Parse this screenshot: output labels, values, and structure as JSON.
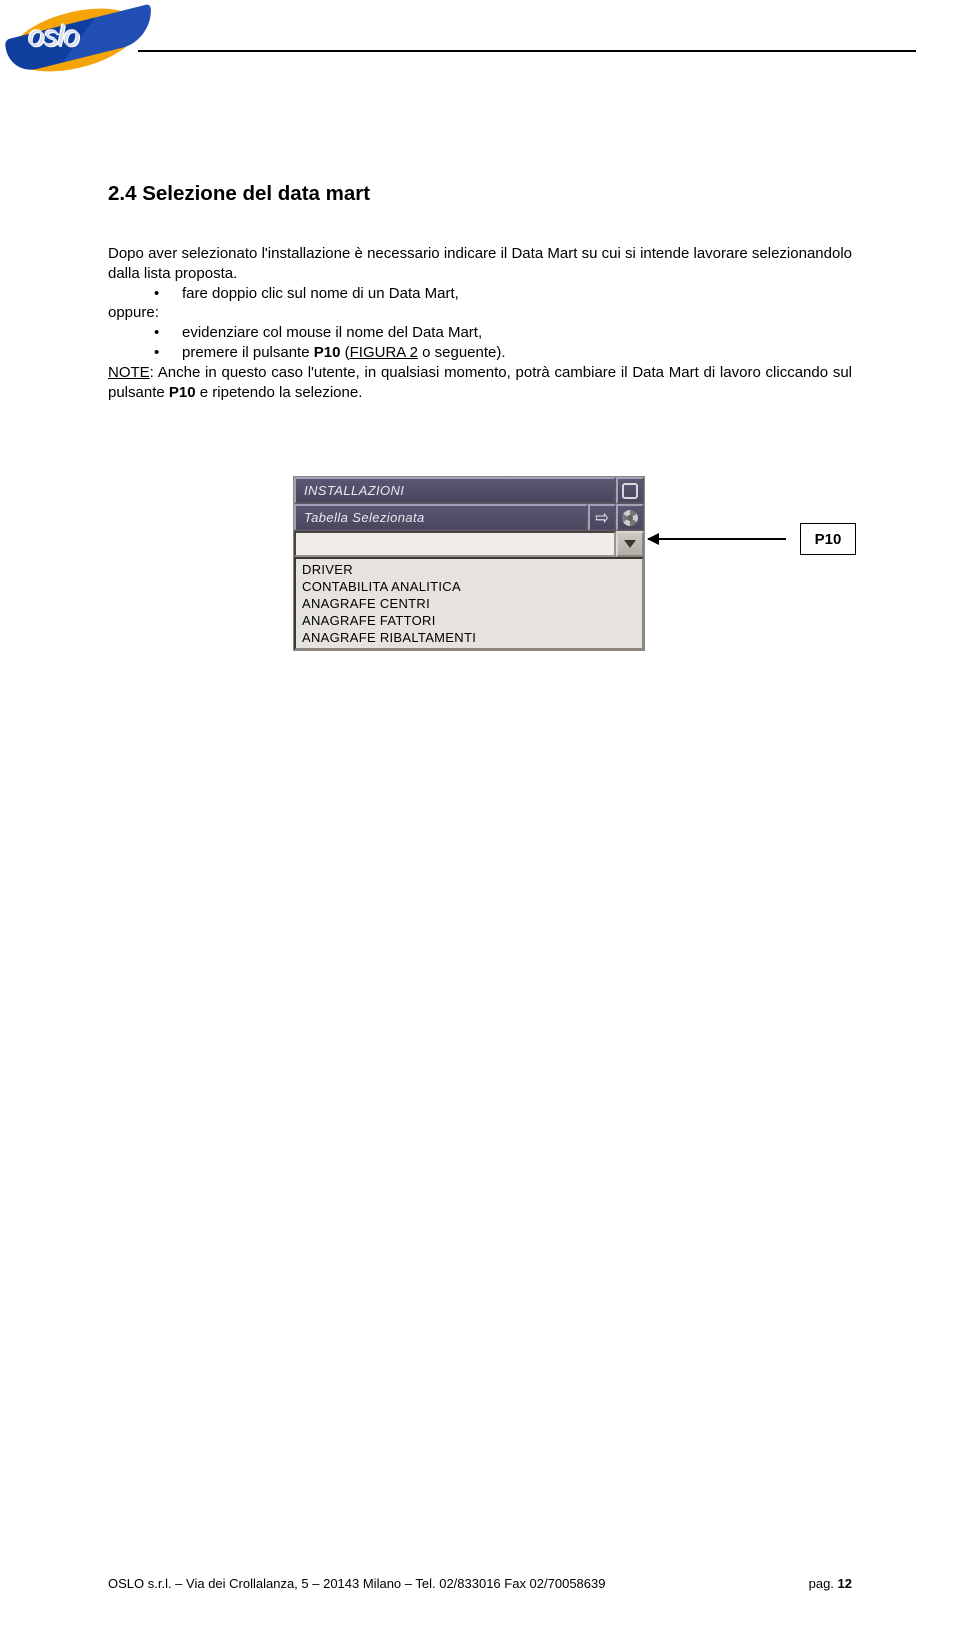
{
  "logo": {
    "text": "oslo"
  },
  "section": {
    "title": "2.4 Selezione del data mart",
    "para1": "Dopo aver selezionato l'installazione è necessario indicare il Data Mart su cui si intende lavorare selezionandolo dalla lista proposta.",
    "bullet1": "fare doppio clic sul nome di un Data Mart,",
    "oppure": "oppure:",
    "bullet2": "evidenziare col mouse il nome del Data Mart,",
    "bullet3_pre": "premere il pulsante ",
    "bullet3_bold": "P10",
    "bullet3_mid": " (",
    "bullet3_link": "FIGURA 2",
    "bullet3_post": " o seguente).",
    "note_label": "NOTE",
    "note_mid1": ": Anche in questo caso l'utente, in qualsiasi momento, potrà cambiare il Data Mart di lavoro cliccando sul pulsante ",
    "note_bold": "P10",
    "note_mid2": " e ripetendo la selezione."
  },
  "panel": {
    "row1_title": "INSTALLAZIONI",
    "row2_title": "Tabella Selezionata",
    "list_items": [
      "DRIVER",
      "CONTABILITA ANALITICA",
      "ANAGRAFE CENTRI",
      "ANAGRAFE FATTORI",
      "ANAGRAFE RIBALTAMENTI"
    ]
  },
  "callout": {
    "label": "P10"
  },
  "footer": {
    "left": "OSLO s.r.l. – Via dei Crollalanza, 5 – 20143 Milano – Tel. 02/833016  Fax 02/70058639",
    "right_pre": "pag. ",
    "right_num": "12"
  }
}
